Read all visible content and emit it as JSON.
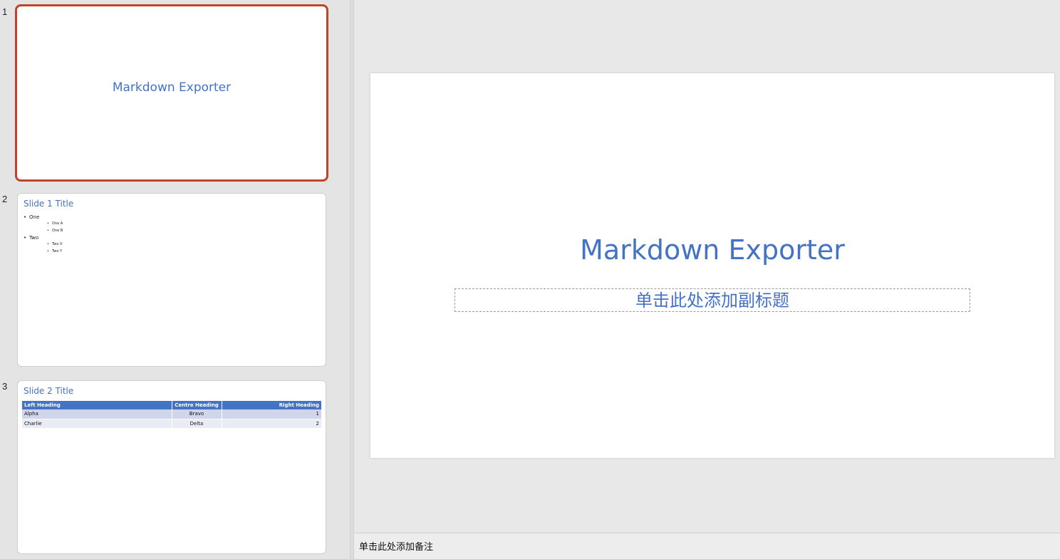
{
  "thumbnails": [
    {
      "number": "1",
      "title": "Markdown Exporter"
    },
    {
      "number": "2",
      "title": "Slide 1 Title",
      "bullets": [
        {
          "text": "One",
          "children": [
            "One A",
            "One B"
          ]
        },
        {
          "text": "Two",
          "children": [
            "Two X",
            "Two Y"
          ]
        }
      ]
    },
    {
      "number": "3",
      "title": "Slide 2 Title",
      "table": {
        "headers": [
          "Left Heading",
          "Centre Heading",
          "Right Heading"
        ],
        "rows": [
          [
            "Alpha",
            "Bravo",
            "1"
          ],
          [
            "Charlie",
            "Delta",
            "2"
          ]
        ]
      }
    }
  ],
  "main_slide": {
    "title": "Markdown Exporter",
    "subtitle_placeholder": "单击此处添加副标题"
  },
  "notes": {
    "placeholder": "单击此处添加备注"
  },
  "colors": {
    "accent": "#4472c4",
    "selection": "#c0432b"
  }
}
